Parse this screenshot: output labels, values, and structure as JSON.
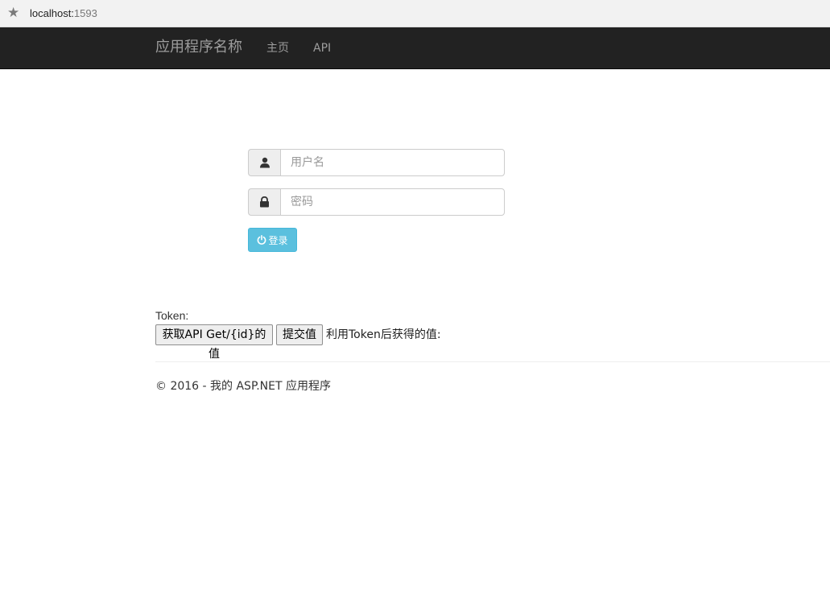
{
  "browser": {
    "url_host": "localhost:",
    "url_port": "1593"
  },
  "navbar": {
    "brand": "应用程序名称",
    "links": [
      "主页",
      "API"
    ]
  },
  "login_form": {
    "username_placeholder": "用户名",
    "password_placeholder": "密码",
    "login_button_label": "登录"
  },
  "token_section": {
    "token_label": "Token:",
    "get_button_label": "获取API Get/{id}的值",
    "submit_button_label": "提交值",
    "result_label": "利用Token后获得的值:"
  },
  "footer": {
    "text": "© 2016 - 我的 ASP.NET 应用程序"
  },
  "colors": {
    "navbar_bg": "#222222",
    "nav_text": "#9d9d9d",
    "login_button": "#5bc0de"
  },
  "icons": {
    "bookmark": "star-icon",
    "username_addon": "user-icon",
    "password_addon": "lock-icon",
    "login": "power-icon"
  }
}
